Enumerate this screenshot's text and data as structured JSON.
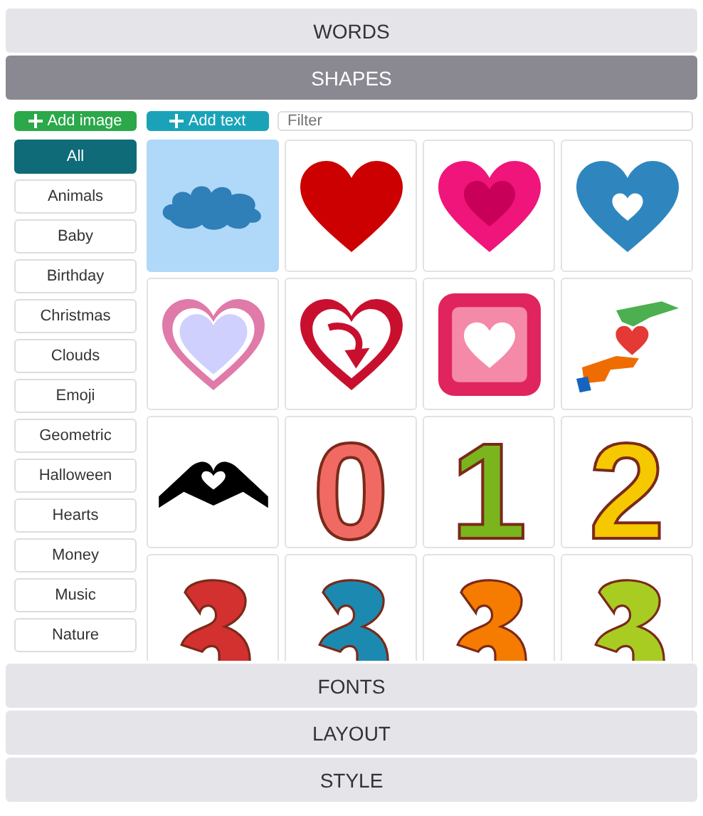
{
  "sections_top": [
    {
      "label": "WORDS",
      "selected": false
    },
    {
      "label": "SHAPES",
      "selected": true
    }
  ],
  "toolbar": {
    "add_image": "Add image",
    "add_text": "Add text",
    "filter": {
      "placeholder": "Filter"
    }
  },
  "categories": [
    {
      "label": "All",
      "selected": true
    },
    {
      "label": "Animals",
      "selected": false
    },
    {
      "label": "Baby",
      "selected": false
    },
    {
      "label": "Birthday",
      "selected": false
    },
    {
      "label": "Christmas",
      "selected": false
    },
    {
      "label": "Clouds",
      "selected": false
    },
    {
      "label": "Emoji",
      "selected": false
    },
    {
      "label": "Geometric",
      "selected": false
    },
    {
      "label": "Halloween",
      "selected": false
    },
    {
      "label": "Hearts",
      "selected": false
    },
    {
      "label": "Money",
      "selected": false
    },
    {
      "label": "Music",
      "selected": false
    },
    {
      "label": "Nature",
      "selected": false
    }
  ],
  "shapes": [
    {
      "kind": "cloud",
      "selected": true
    },
    {
      "kind": "heart-solid",
      "selected": false
    },
    {
      "kind": "heart-double",
      "selected": false
    },
    {
      "kind": "heart-hole",
      "selected": false
    },
    {
      "kind": "heart-outline",
      "selected": false
    },
    {
      "kind": "heart-arrow",
      "selected": false
    },
    {
      "kind": "heart-square",
      "selected": false
    },
    {
      "kind": "hands-heart",
      "selected": false
    },
    {
      "kind": "hands-heart-black",
      "selected": false
    },
    {
      "kind": "digit",
      "label": "0",
      "selected": false
    },
    {
      "kind": "digit",
      "label": "1",
      "selected": false
    },
    {
      "kind": "digit",
      "label": "2",
      "selected": false
    },
    {
      "kind": "clipart",
      "color": "#d33030",
      "selected": false
    },
    {
      "kind": "clipart",
      "color": "#1c8ab0",
      "selected": false
    },
    {
      "kind": "clipart",
      "color": "#f57c00",
      "selected": false
    },
    {
      "kind": "clipart",
      "color": "#a8cc22",
      "selected": false
    }
  ],
  "sections_bottom": [
    {
      "label": "FONTS",
      "selected": false
    },
    {
      "label": "LAYOUT",
      "selected": false
    },
    {
      "label": "STYLE",
      "selected": false
    }
  ]
}
